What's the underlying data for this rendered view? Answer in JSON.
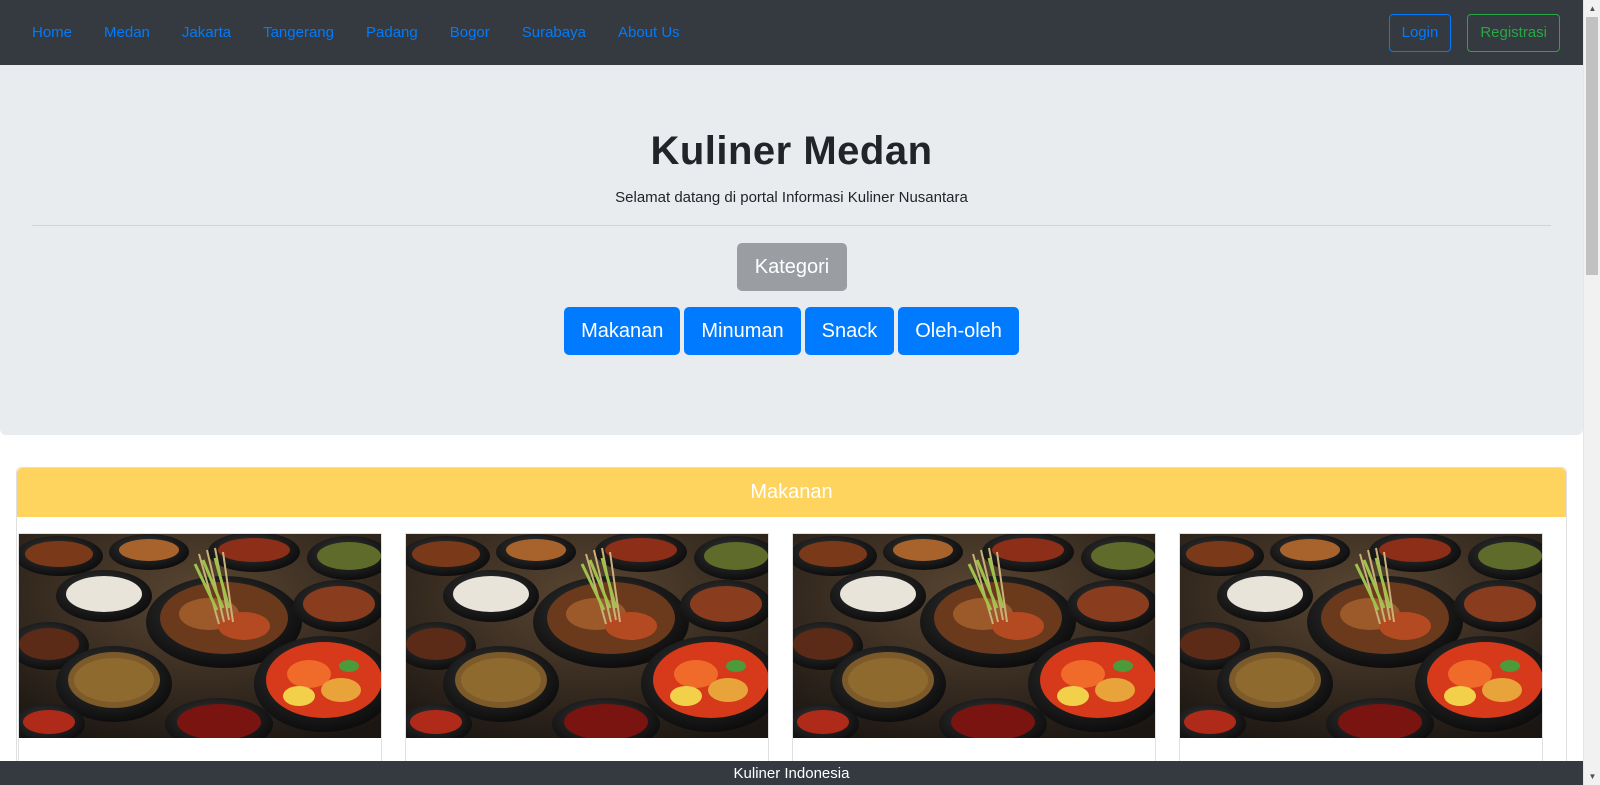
{
  "nav": {
    "links": [
      "Home",
      "Medan",
      "Jakarta",
      "Tangerang",
      "Padang",
      "Bogor",
      "Surabaya",
      "About Us"
    ],
    "login_label": "Login",
    "register_label": "Registrasi"
  },
  "hero": {
    "title": "Kuliner Medan",
    "subtitle": "Selamat datang di portal Informasi Kuliner Nusantara",
    "kategori_label": "Kategori",
    "categories": [
      "Makanan",
      "Minuman",
      "Snack",
      "Oleh-oleh"
    ]
  },
  "section": {
    "title": "Makanan",
    "items": [
      {
        "image": "indonesian-food-spread"
      },
      {
        "image": "indonesian-food-spread"
      },
      {
        "image": "indonesian-food-spread"
      },
      {
        "image": "indonesian-food-spread"
      }
    ]
  },
  "footer": {
    "text": "Kuliner Indonesia"
  },
  "colors": {
    "navbar": "#343a40",
    "link": "#007bff",
    "success": "#28a745",
    "jumbotron": "#e9ecef",
    "primary_button": "#007bff",
    "secondary_button": "#9a9ea3",
    "section_header": "#ffd45e"
  }
}
